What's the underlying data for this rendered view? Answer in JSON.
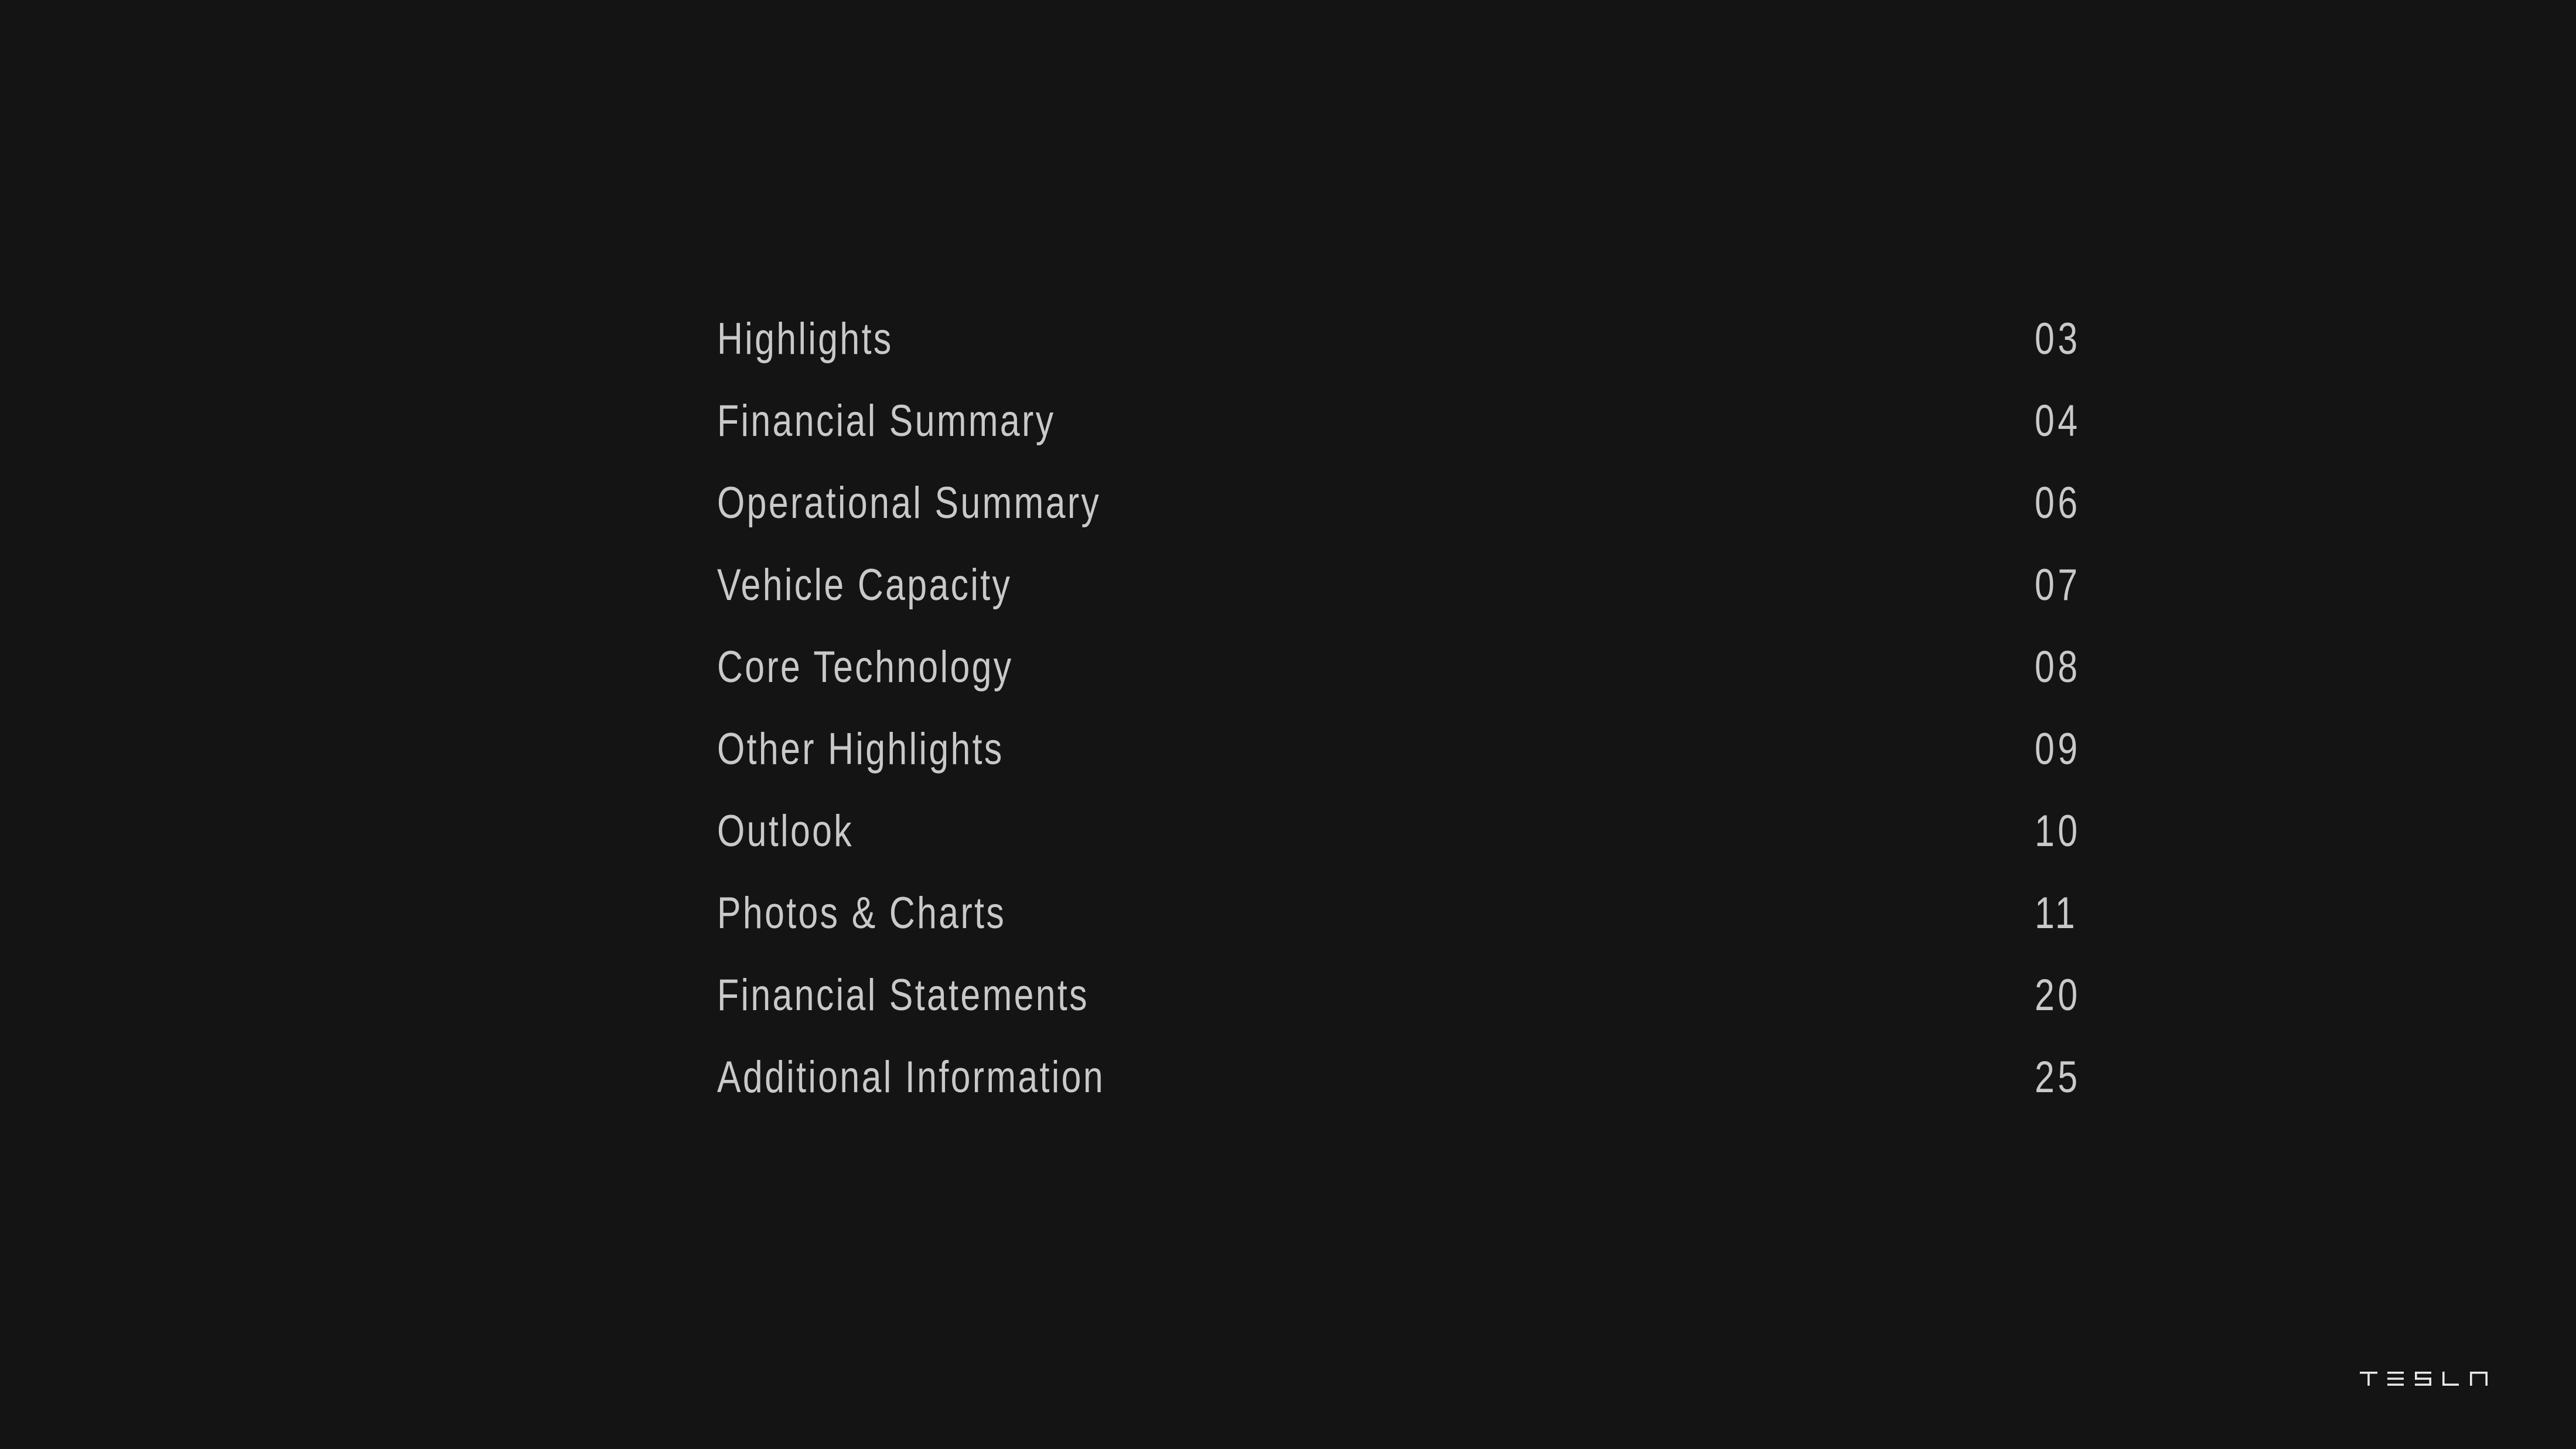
{
  "document": {
    "background_color": "#141414",
    "text_color": "#c9c9c9",
    "type": "table-of-contents"
  },
  "toc": {
    "entries": [
      {
        "title": "Highlights",
        "page": "03"
      },
      {
        "title": "Financial Summary",
        "page": "04"
      },
      {
        "title": "Operational Summary",
        "page": "06"
      },
      {
        "title": "Vehicle Capacity",
        "page": "07"
      },
      {
        "title": "Core Technology",
        "page": "08"
      },
      {
        "title": "Other Highlights",
        "page": "09"
      },
      {
        "title": "Outlook",
        "page": "10"
      },
      {
        "title": "Photos & Charts",
        "page": "11"
      },
      {
        "title": "Financial Statements",
        "page": "20"
      },
      {
        "title": "Additional Information",
        "page": "25"
      }
    ]
  },
  "footer": {
    "logo": {
      "icon": "tesla-wordmark-logo",
      "text": "TESLA",
      "color": "#e8e8e8"
    }
  }
}
